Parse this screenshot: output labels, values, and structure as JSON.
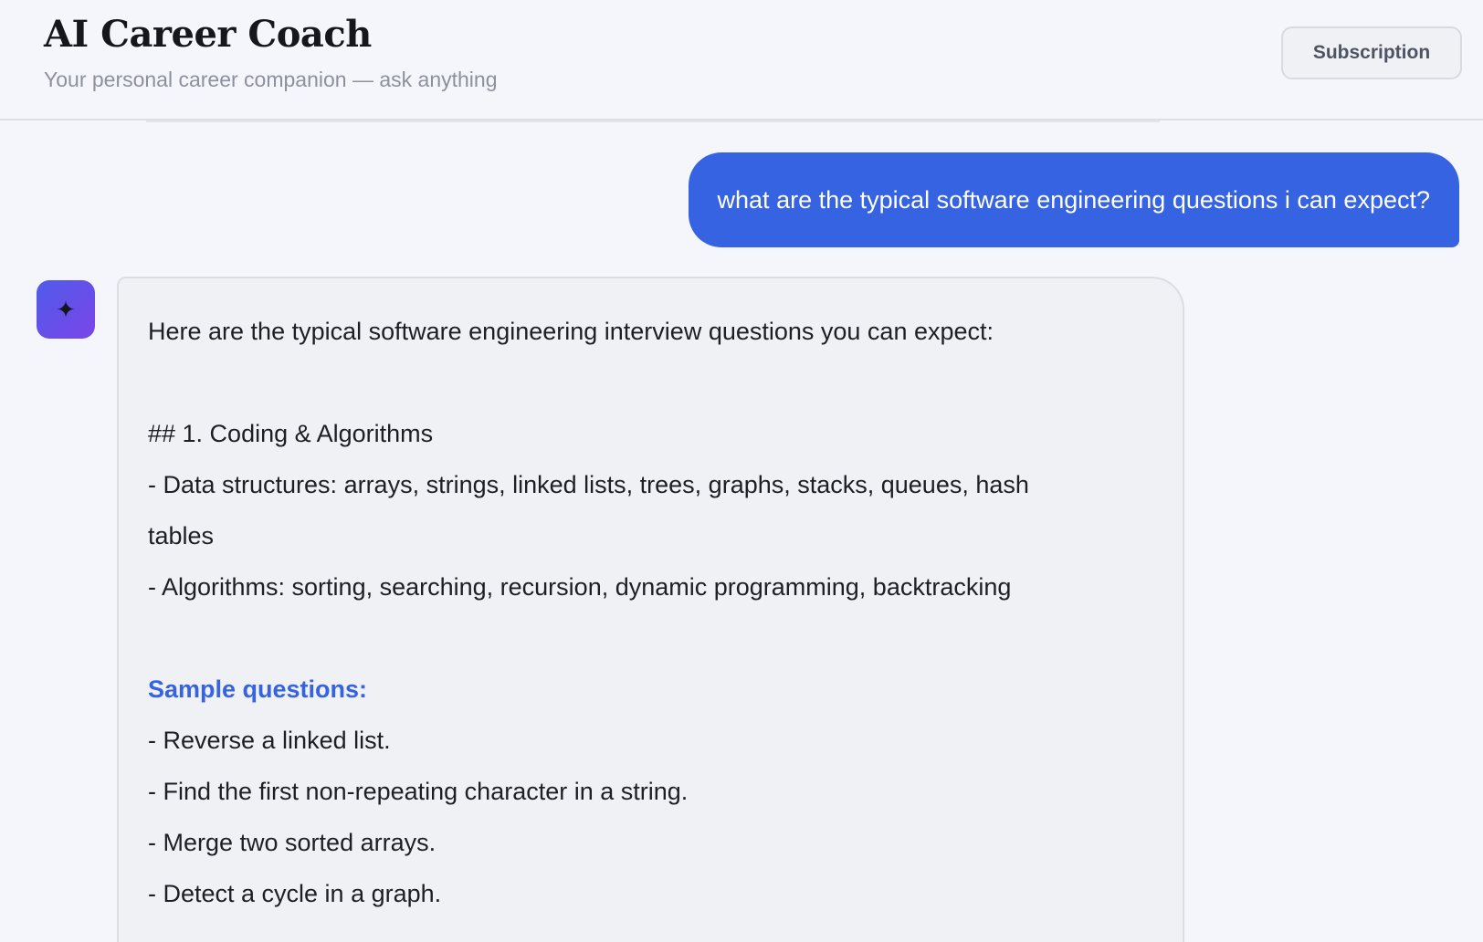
{
  "header": {
    "title": "AI Career Coach",
    "subtitle": "Your personal career companion — ask anything",
    "subscription_label": "Subscription"
  },
  "chat": {
    "user_message": "what are the typical software engineering questions i can expect?",
    "assistant_avatar_icon": "sparkle-icon",
    "assistant_lines": [
      "Here are the typical software engineering interview questions you can expect:",
      "",
      "## 1. Coding & Algorithms",
      "- Data structures: arrays, strings, linked lists, trees, graphs, stacks, queues, hash",
      "tables",
      "- Algorithms: sorting, searching, recursion, dynamic programming, backtracking",
      "",
      "Sample questions:",
      "- Reverse a linked list.",
      "- Find the first non-repeating character in a string.",
      "- Merge two sorted arrays.",
      "- Detect a cycle in a graph."
    ]
  },
  "colors": {
    "accent": "#3663e2",
    "background": "#f5f6fb",
    "assistant_bubble": "#f0f1f5"
  }
}
